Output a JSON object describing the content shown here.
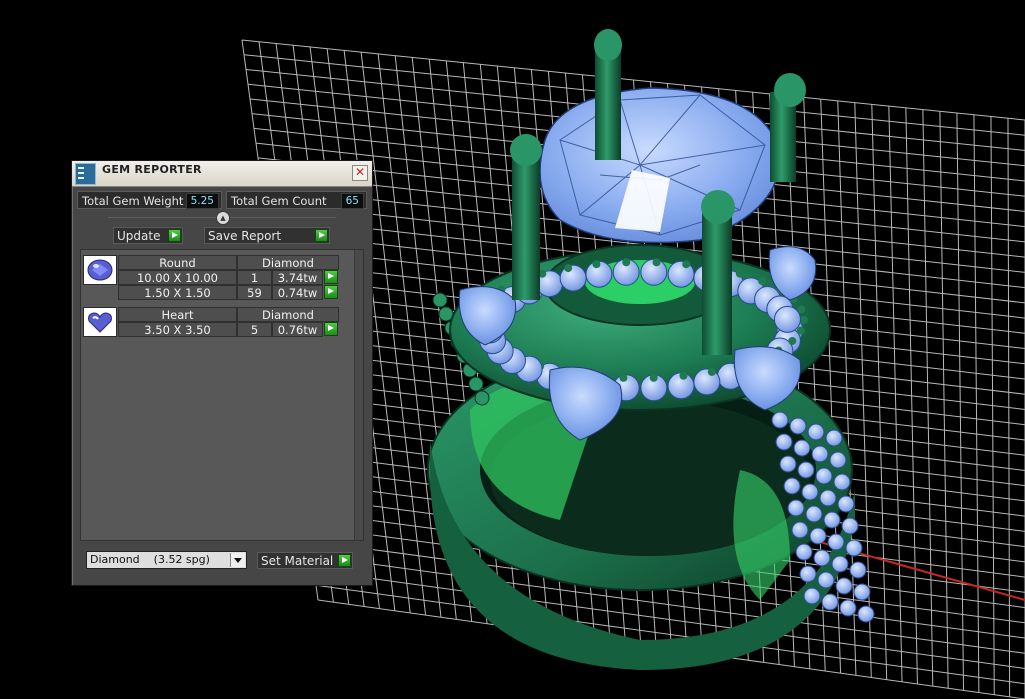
{
  "panel": {
    "title": "GEM REPORTER",
    "close_glyph": "✕",
    "total_weight_label": "Total Gem Weight",
    "total_weight_value": "5.25",
    "total_count_label": "Total Gem Count",
    "total_count_value": "65",
    "update_label": "Update",
    "save_report_label": "Save Report",
    "groups": [
      {
        "shape": "Round",
        "material": "Diamond",
        "icon": "round-gem-icon",
        "rows": [
          {
            "size": "10.00 X 10.00",
            "count": "1",
            "weight": "3.74tw"
          },
          {
            "size": "1.50 X 1.50",
            "count": "59",
            "weight": "0.74tw"
          }
        ]
      },
      {
        "shape": "Heart",
        "material": "Diamond",
        "icon": "heart-gem-icon",
        "rows": [
          {
            "size": "3.50 X 3.50",
            "count": "5",
            "weight": "0.76tw"
          }
        ]
      }
    ],
    "material_select": "Diamond    (3.52 spg)",
    "set_material_label": "Set Material"
  },
  "colors": {
    "background": "#000000",
    "grid": "#ffffff",
    "metal": "#1e7a52",
    "gem": "#7fa6ea",
    "axis": "#c8281e",
    "accent_go": "#2ea32a"
  }
}
